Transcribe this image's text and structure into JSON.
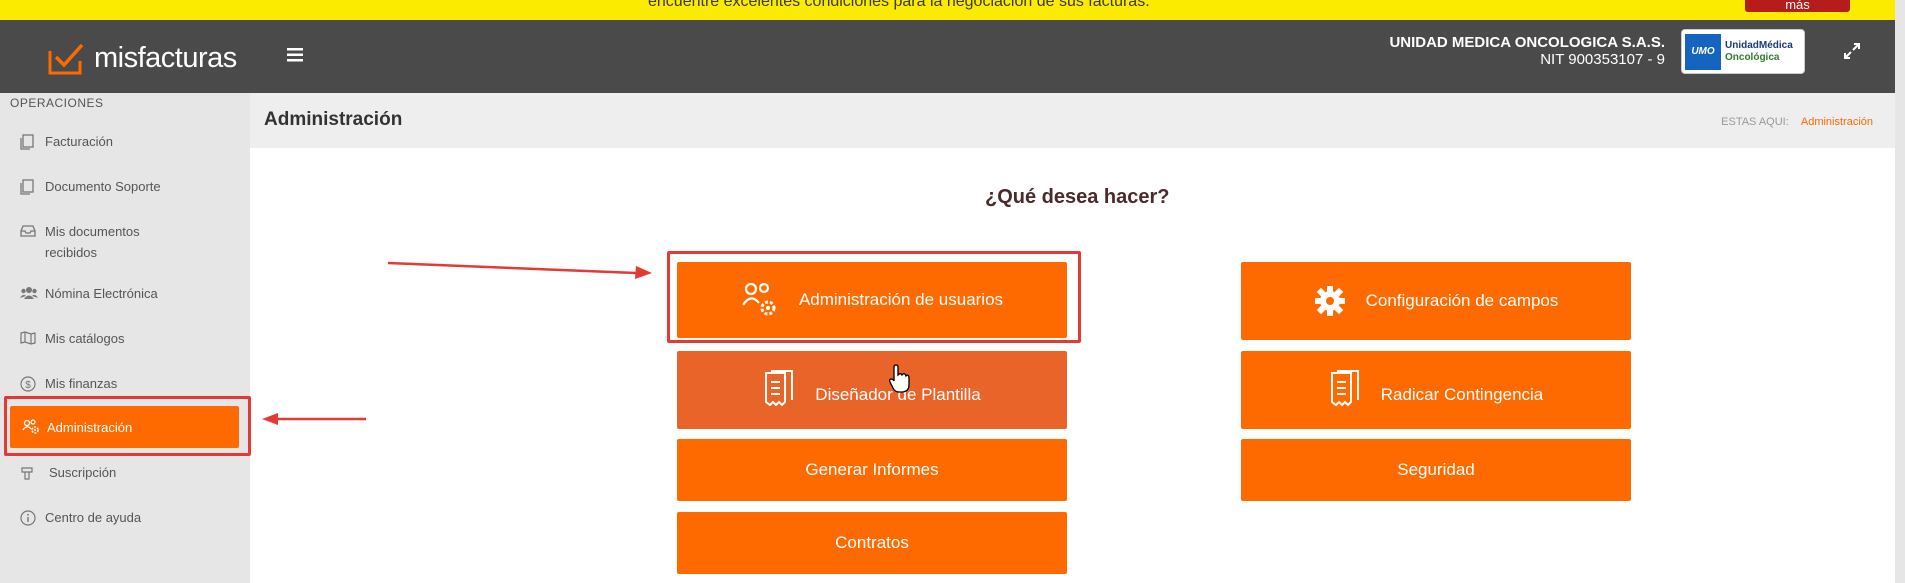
{
  "banner": {
    "text": "encuentre excelentes condiciones para la negociación de sus facturas.",
    "button_label": "más"
  },
  "header": {
    "app_name": "misfacturas",
    "company_name": "UNIDAD MEDICA ONCOLOGICA S.A.S.",
    "company_nit": "NIT 900353107 - 9",
    "company_logo_line1": "UnidadMédica",
    "company_logo_line2": "Oncológica",
    "company_logo_mark": "UMO"
  },
  "sidebar": {
    "section_title": "OPERACIONES",
    "items": [
      {
        "label": "Facturación",
        "icon": "document-icon"
      },
      {
        "label": "Documento Soporte",
        "icon": "document-icon"
      },
      {
        "label": "Mis documentos recibidos",
        "icon": "inbox-icon"
      },
      {
        "label": "Nómina Electrónica",
        "icon": "users-icon"
      },
      {
        "label": "Mis catálogos",
        "icon": "map-icon"
      },
      {
        "label": "Mis finanzas",
        "icon": "dollar-icon"
      },
      {
        "label": "Administración",
        "icon": "users-gear-icon"
      },
      {
        "label": "Suscripción",
        "icon": "hand-icon"
      },
      {
        "label": "Centro de ayuda",
        "icon": "info-icon"
      }
    ]
  },
  "page": {
    "title": "Administración",
    "breadcrumb_prefix": "ESTAS AQUI:",
    "breadcrumb_current": "Administración",
    "question": "¿Qué desea hacer?"
  },
  "actions": {
    "admin_users": "Administración de usuarios",
    "config_fields": "Configuración de campos",
    "template_designer": "Diseñador de Plantilla",
    "file_contingency": "Radicar Contingencia",
    "reports": "Generar Informes",
    "security": "Seguridad",
    "contracts": "Contratos"
  },
  "colors": {
    "accent": "#ff6a00",
    "header": "#4a4a4a",
    "banner": "#fbeb00",
    "highlight": "#e53935"
  }
}
